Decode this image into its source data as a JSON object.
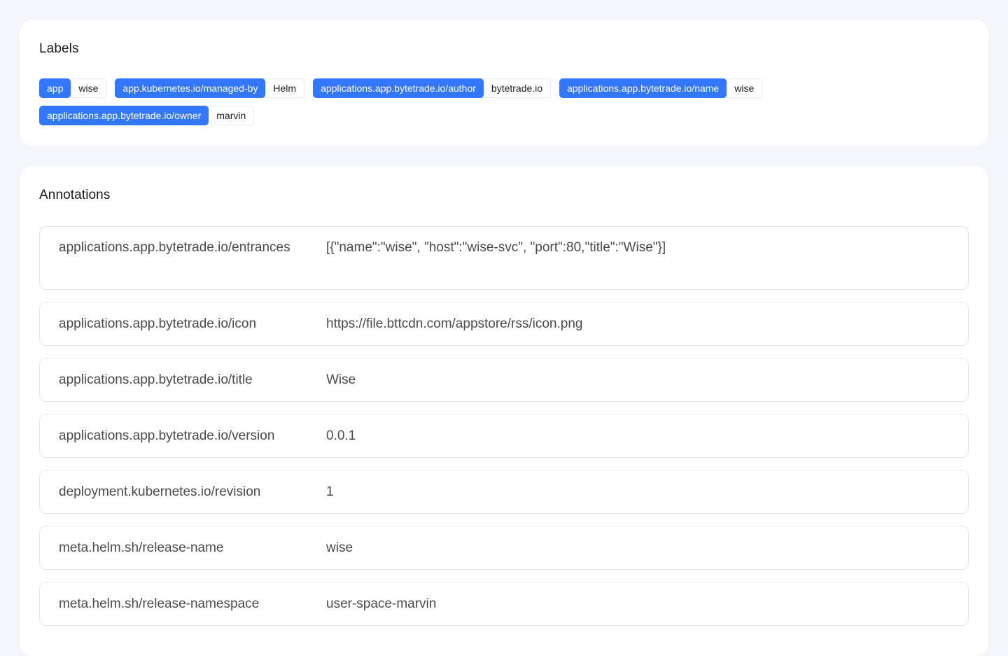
{
  "labels": {
    "title": "Labels",
    "items": [
      {
        "key": "app",
        "value": "wise"
      },
      {
        "key": "app.kubernetes.io/managed-by",
        "value": "Helm"
      },
      {
        "key": "applications.app.bytetrade.io/author",
        "value": "bytetrade.io"
      },
      {
        "key": "applications.app.bytetrade.io/name",
        "value": "wise"
      },
      {
        "key": "applications.app.bytetrade.io/owner",
        "value": "marvin"
      }
    ]
  },
  "annotations": {
    "title": "Annotations",
    "items": [
      {
        "key": "applications.app.bytetrade.io/entrances",
        "value": "[{\"name\":\"wise\", \"host\":\"wise-svc\", \"port\":80,\"title\":\"Wise\"}]"
      },
      {
        "key": "applications.app.bytetrade.io/icon",
        "value": "https://file.bttcdn.com/appstore/rss/icon.png"
      },
      {
        "key": "applications.app.bytetrade.io/title",
        "value": "Wise"
      },
      {
        "key": "applications.app.bytetrade.io/version",
        "value": "0.0.1"
      },
      {
        "key": "deployment.kubernetes.io/revision",
        "value": "1"
      },
      {
        "key": "meta.helm.sh/release-name",
        "value": "wise"
      },
      {
        "key": "meta.helm.sh/release-namespace",
        "value": "user-space-marvin"
      }
    ]
  },
  "colors": {
    "accent": "#3377ff",
    "background": "#f4f6fb",
    "card": "#ffffff"
  }
}
